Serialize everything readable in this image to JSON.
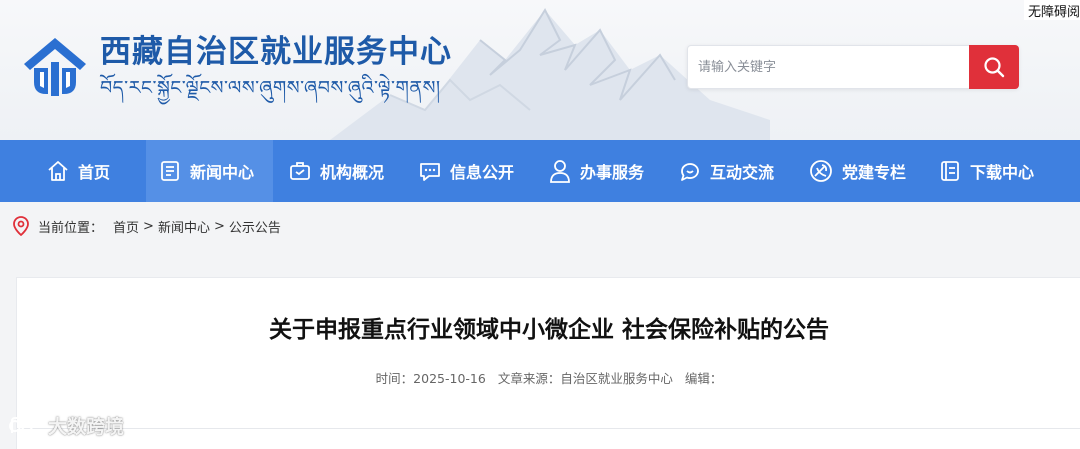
{
  "accessibility_label": "无障碍阅读",
  "site": {
    "title": "西藏自治区就业服务中心",
    "tibetan": "བོད་རང་སྐྱོང་ལྗོངས་ལས་ཞུགས་ཞབས་ཞུའི་ལྟེ་གནས།"
  },
  "search": {
    "placeholder": "请输入关键字",
    "value": ""
  },
  "nav": [
    {
      "label": "首页",
      "icon": "home-icon"
    },
    {
      "label": "新闻中心",
      "icon": "news-icon",
      "active": true
    },
    {
      "label": "机构概况",
      "icon": "briefcase-icon"
    },
    {
      "label": "信息公开",
      "icon": "message-icon"
    },
    {
      "label": "办事服务",
      "icon": "person-icon"
    },
    {
      "label": "互动交流",
      "icon": "chat-icon"
    },
    {
      "label": "党建专栏",
      "icon": "party-emblem-icon"
    },
    {
      "label": "下载中心",
      "icon": "document-icon"
    }
  ],
  "breadcrumb": {
    "prefix": "当前位置：",
    "items": [
      "首页",
      "新闻中心",
      "公示公告"
    ],
    "separator": ">"
  },
  "article": {
    "title": "关于申报重点行业领域中小微企业 社会保险补贴的公告",
    "time_label": "时间：",
    "time": "2025-10-16",
    "source_label": "文章来源：",
    "source": "自治区就业服务中心",
    "editor_label": "编辑："
  },
  "watermark": "大数跨境",
  "colors": {
    "brand_blue": "#1e5aa8",
    "nav_blue": "#3f80e0",
    "search_red": "#e0303a"
  }
}
